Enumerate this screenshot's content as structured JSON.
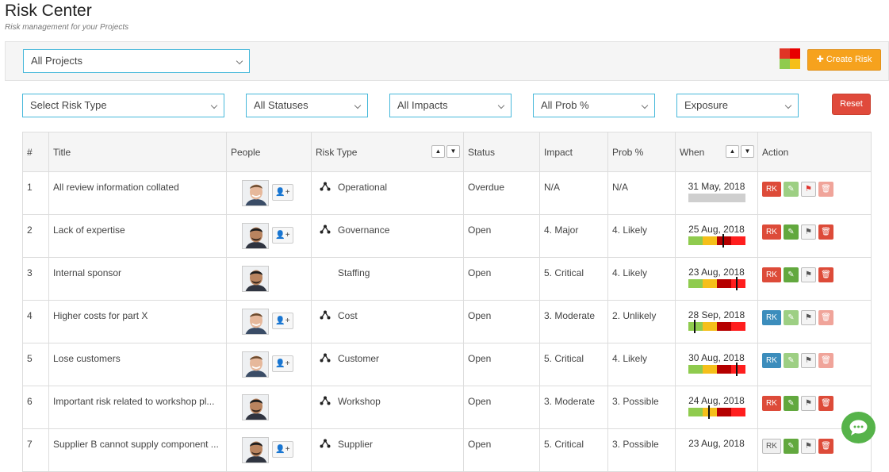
{
  "header": {
    "title": "Risk Center",
    "subtitle": "Risk management for your Projects"
  },
  "project_select": {
    "value": "All Projects"
  },
  "create_button": {
    "label": "Create Risk",
    "icon": "plus-icon"
  },
  "exposure_mini_colors": [
    "#e03426",
    "#e80000",
    "#8fcb4e",
    "#f5bf1a"
  ],
  "filters": {
    "risk_type": "Select Risk Type",
    "status": "All Statuses",
    "impact": "All Impacts",
    "prob": "All Prob %",
    "exposure": "Exposure",
    "reset_label": "Reset"
  },
  "table": {
    "headers": [
      "#",
      "Title",
      "People",
      "Risk Type",
      "Status",
      "Impact",
      "Prob %",
      "When",
      "Action"
    ],
    "sort_up": "▲",
    "sort_down": "▼",
    "rk_label": "RK",
    "rows": [
      {
        "num": "1",
        "title": "All review information collated",
        "person": "young-man-avatar",
        "adduser": true,
        "risk_type": "Operational",
        "rt_icon": true,
        "status": "Overdue",
        "impact": "N/A",
        "prob": "N/A",
        "when": "31 May, 2018",
        "exposure": null,
        "rk": "red",
        "edit_light": true,
        "flag_red": true,
        "del_light": true
      },
      {
        "num": "2",
        "title": "Lack of expertise",
        "person": "man-avatar",
        "adduser": true,
        "risk_type": "Governance",
        "rt_icon": true,
        "status": "Open",
        "impact": "4. Major",
        "prob": "4. Likely",
        "when": "25 Aug, 2018",
        "exposure": 0.62,
        "rk": "red",
        "edit_light": false,
        "flag_red": false,
        "del_light": false
      },
      {
        "num": "3",
        "title": "Internal sponsor",
        "person": "man-avatar",
        "adduser": false,
        "risk_type": "Staffing",
        "rt_icon": false,
        "status": "Open",
        "impact": "5. Critical",
        "prob": "4. Likely",
        "when": "23 Aug, 2018",
        "exposure": 0.85,
        "rk": "red",
        "edit_light": false,
        "flag_red": false,
        "del_light": false
      },
      {
        "num": "4",
        "title": "Higher costs for part X",
        "person": "young-man-avatar",
        "adduser": true,
        "risk_type": "Cost",
        "rt_icon": true,
        "status": "Open",
        "impact": "3. Moderate",
        "prob": "2. Unlikely",
        "when": "28 Sep, 2018",
        "exposure": 0.12,
        "rk": "blue",
        "edit_light": true,
        "flag_red": false,
        "del_light": true
      },
      {
        "num": "5",
        "title": "Lose customers",
        "person": "young-man-avatar",
        "adduser": true,
        "risk_type": "Customer",
        "rt_icon": true,
        "status": "Open",
        "impact": "5. Critical",
        "prob": "4. Likely",
        "when": "30 Aug, 2018",
        "exposure": 0.85,
        "rk": "blue",
        "edit_light": true,
        "flag_red": false,
        "del_light": true
      },
      {
        "num": "6",
        "title": "Important risk related to workshop pl...",
        "person": "man-avatar",
        "adduser": false,
        "risk_type": "Workshop",
        "rt_icon": true,
        "status": "Open",
        "impact": "3. Moderate",
        "prob": "3. Possible",
        "when": "24 Aug, 2018",
        "exposure": 0.37,
        "rk": "red",
        "edit_light": false,
        "flag_red": false,
        "del_light": false
      },
      {
        "num": "7",
        "title": "Supplier B cannot supply component ...",
        "person": "man-avatar",
        "adduser": true,
        "risk_type": "Supplier",
        "rt_icon": true,
        "status": "Open",
        "impact": "5. Critical",
        "prob": "3. Possible",
        "when": "23 Aug, 2018",
        "exposure": null,
        "rk": "grey",
        "edit_light": false,
        "flag_red": false,
        "del_light": false
      }
    ]
  },
  "exposure_bar_colors": [
    "#8fcb4e",
    "#f5bf1a",
    "#b50000",
    "#ff1e1e"
  ],
  "chat_icon": "chat-bubble-icon"
}
